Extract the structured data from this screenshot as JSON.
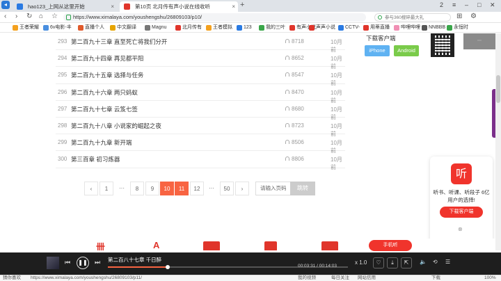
{
  "browser": {
    "tabs": [
      {
        "label": "hao123_上网从这里开始",
        "icon_color": "#2a7ae2"
      },
      {
        "label": "第10页 北月传有声小说在线收听",
        "icon_color": "#e0352b"
      }
    ],
    "window_controls": [
      "2",
      "≡",
      "–",
      "□",
      "✕"
    ],
    "url": "https://www.ximalaya.com/youshengshu/26809103/p10/",
    "search_placeholder": "参与360搜碎最大礼",
    "bookmarks": [
      {
        "label": "王者荣耀",
        "color": "#f4a11f"
      },
      {
        "label": "6v电影-丰",
        "color": "#4a8fe0"
      },
      {
        "label": "直播个人",
        "color": "#e05a2b"
      },
      {
        "label": "中文翻译",
        "color": "#e6a400"
      },
      {
        "label": "Magnu",
        "color": "#777777"
      },
      {
        "label": "北月传有",
        "color": "#e0352b"
      },
      {
        "label": "王者模拟",
        "color": "#f4a11f"
      },
      {
        "label": "123",
        "color": "#2a7ae2"
      },
      {
        "label": "我的三叶",
        "color": "#3aa64a"
      },
      {
        "label": "有声小说",
        "color": "#e0352b"
      },
      {
        "label": "声声小说",
        "color": "#e0352b"
      },
      {
        "label": "CCTV-",
        "color": "#2a7ae2"
      },
      {
        "label": "用蒂直播",
        "color": "#e0352b"
      },
      {
        "label": "哔哩哔哩",
        "color": "#f08fb4"
      },
      {
        "label": "NNBBB",
        "color": "#555555"
      },
      {
        "label": "永恒时",
        "color": "#3aa64a"
      }
    ]
  },
  "tracks": [
    {
      "num": "293",
      "title": "第二百九十三章 直至死亡将我们分开",
      "plays": "8718",
      "date": "10月前"
    },
    {
      "num": "294",
      "title": "第二百九十四章 再见都平阳",
      "plays": "8652",
      "date": "10月前"
    },
    {
      "num": "295",
      "title": "第二百九十五章 选择与任务",
      "plays": "8547",
      "date": "10月前"
    },
    {
      "num": "296",
      "title": "第二百九十六章 两只蚂蚁",
      "plays": "8470",
      "date": "10月前"
    },
    {
      "num": "297",
      "title": "第二百九十七章 云笈七签",
      "plays": "8680",
      "date": "10月前"
    },
    {
      "num": "298",
      "title": "第二百九十八章 小说家的崛起之夜",
      "plays": "8723",
      "date": "10月前"
    },
    {
      "num": "299",
      "title": "第二百九十九章 新开端",
      "plays": "8506",
      "date": "10月前"
    },
    {
      "num": "300",
      "title": "第三百章 初习炼器",
      "plays": "8806",
      "date": "10月前"
    }
  ],
  "pagination": {
    "prev": "‹",
    "next": "›",
    "pages": [
      "1",
      "···",
      "8",
      "9",
      "10",
      "11",
      "12",
      "···",
      "50"
    ],
    "active": "10",
    "input_placeholder": "请输入页码",
    "jump_label": "跳转"
  },
  "client_download": {
    "title": "下载客户端",
    "ios_label": "iPhone",
    "android_label": "Android"
  },
  "promo": {
    "logo": "听",
    "text": "听书、听课、听段子 6亿用户的选择!",
    "button": "下载客户端"
  },
  "player": {
    "track_title": "第二百八十七章 千日醉",
    "current_time": "00:03:31",
    "total_time": "00:14:03",
    "progress": 0.25,
    "speed": "x 1.0",
    "phone_button": "手机听"
  },
  "status_bar": {
    "left": "猜你喜欢",
    "url": "https://www.ximalaya.com/youshengshu/26809103/p11/",
    "items": [
      "我的视频",
      "每日关注",
      "网站信用",
      "下载",
      "100%"
    ]
  },
  "colors": {
    "accent": "#f86442",
    "brand_red": "#f0342c"
  }
}
